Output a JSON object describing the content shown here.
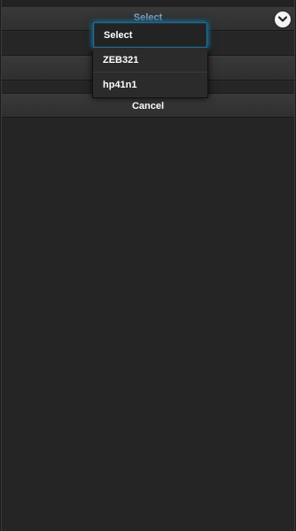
{
  "select": {
    "label": "Select",
    "toggle_icon": "chevron-down-icon"
  },
  "dropdown": {
    "options": [
      {
        "label": "Select",
        "selected": true
      },
      {
        "label": "ZEB321",
        "selected": false
      },
      {
        "label": "hp41n1",
        "selected": false
      }
    ]
  },
  "cancel": {
    "label": "Cancel"
  },
  "colors": {
    "accent": "#2a8ab7",
    "select_label": "#7fb0d8",
    "background": "#252525"
  }
}
